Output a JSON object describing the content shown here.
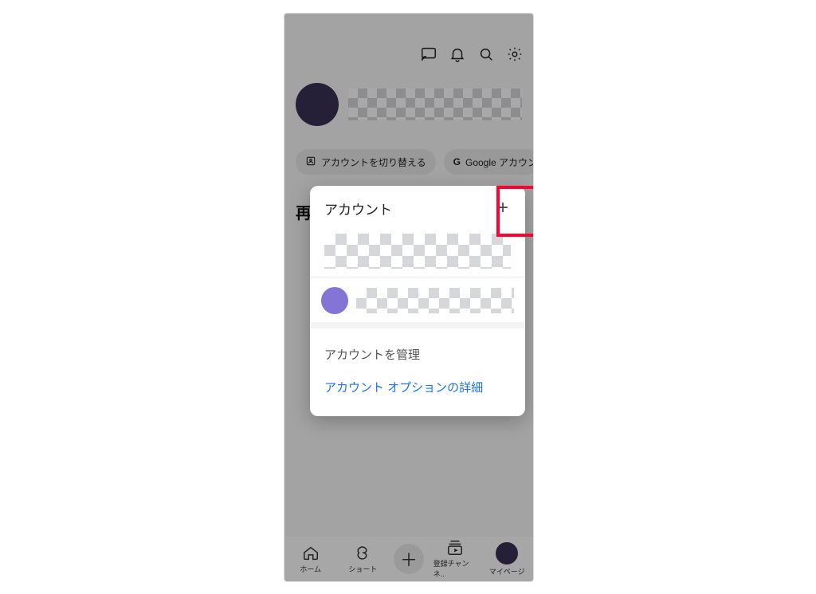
{
  "header": {
    "cast": "cast-icon",
    "bell": "bell-icon",
    "search": "search-icon",
    "settings": "gear-icon"
  },
  "pills": {
    "switch": "アカウントを切り替える",
    "google": "Google アカウン"
  },
  "section": {
    "label_partial": "再"
  },
  "sheet": {
    "title": "アカウント",
    "add_label": "+",
    "manage": "アカウントを管理",
    "options": "アカウント オプションの詳細"
  },
  "bottom": {
    "home": "ホーム",
    "shorts": "ショート",
    "subs": "登録チャンネ..",
    "mypage": "マイページ"
  }
}
